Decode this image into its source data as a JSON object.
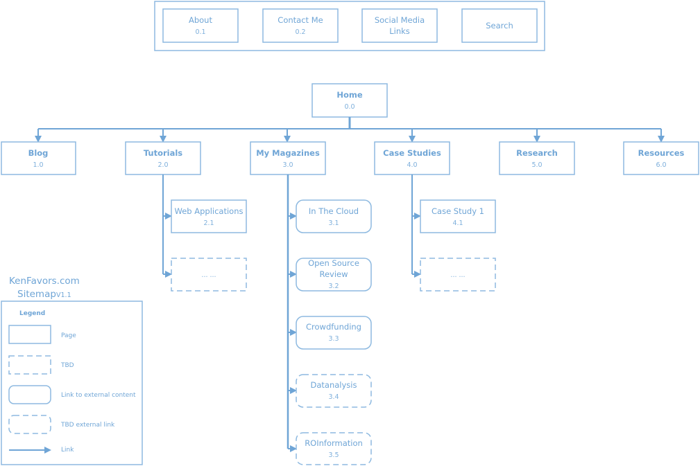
{
  "utility_nav": [
    {
      "label": "About",
      "id": "0.1"
    },
    {
      "label": "Contact Me",
      "id": "0.2"
    },
    {
      "label": "Social Media",
      "label2": "Links"
    },
    {
      "label": "Search"
    }
  ],
  "home": {
    "label": "Home",
    "id": "0.0"
  },
  "sections": [
    {
      "label": "Blog",
      "id": "1.0"
    },
    {
      "label": "Tutorials",
      "id": "2.0"
    },
    {
      "label": "My Magazines",
      "id": "3.0"
    },
    {
      "label": "Case Studies",
      "id": "4.0"
    },
    {
      "label": "Research",
      "id": "5.0"
    },
    {
      "label": "Resources",
      "id": "6.0"
    }
  ],
  "tutorials_children": [
    {
      "label": "Web Applications",
      "id": "2.1",
      "type": "page"
    },
    {
      "label": "... ...",
      "type": "tbd"
    }
  ],
  "magazines_children": [
    {
      "label": "In The Cloud",
      "id": "3.1",
      "type": "external"
    },
    {
      "label": "Open Source",
      "label2": "Review",
      "id": "3.2",
      "type": "external"
    },
    {
      "label": "Crowdfunding",
      "id": "3.3",
      "type": "external"
    },
    {
      "label": "Datanalysis",
      "id": "3.4",
      "type": "tbd-external"
    },
    {
      "label": "ROInformation",
      "id": "3.5",
      "type": "tbd-external"
    }
  ],
  "case_studies_children": [
    {
      "label": "Case Study 1",
      "id": "4.1",
      "type": "page"
    },
    {
      "label": "... ...",
      "type": "tbd"
    }
  ],
  "site": {
    "name": "KenFavors.com",
    "subtitle": "Sitemap",
    "version": "V1.1"
  },
  "legend": {
    "title": "Legend",
    "items": [
      {
        "shape": "page",
        "label": "Page"
      },
      {
        "shape": "tbd",
        "label": "TBD"
      },
      {
        "shape": "external",
        "label": "Link to external content"
      },
      {
        "shape": "tbd-external",
        "label": "TBD external link"
      },
      {
        "shape": "arrow",
        "label": "Link"
      }
    ]
  },
  "colors": {
    "stroke": "#8db9e0",
    "line": "#6fa5d6",
    "text": "#6fa5d6"
  }
}
